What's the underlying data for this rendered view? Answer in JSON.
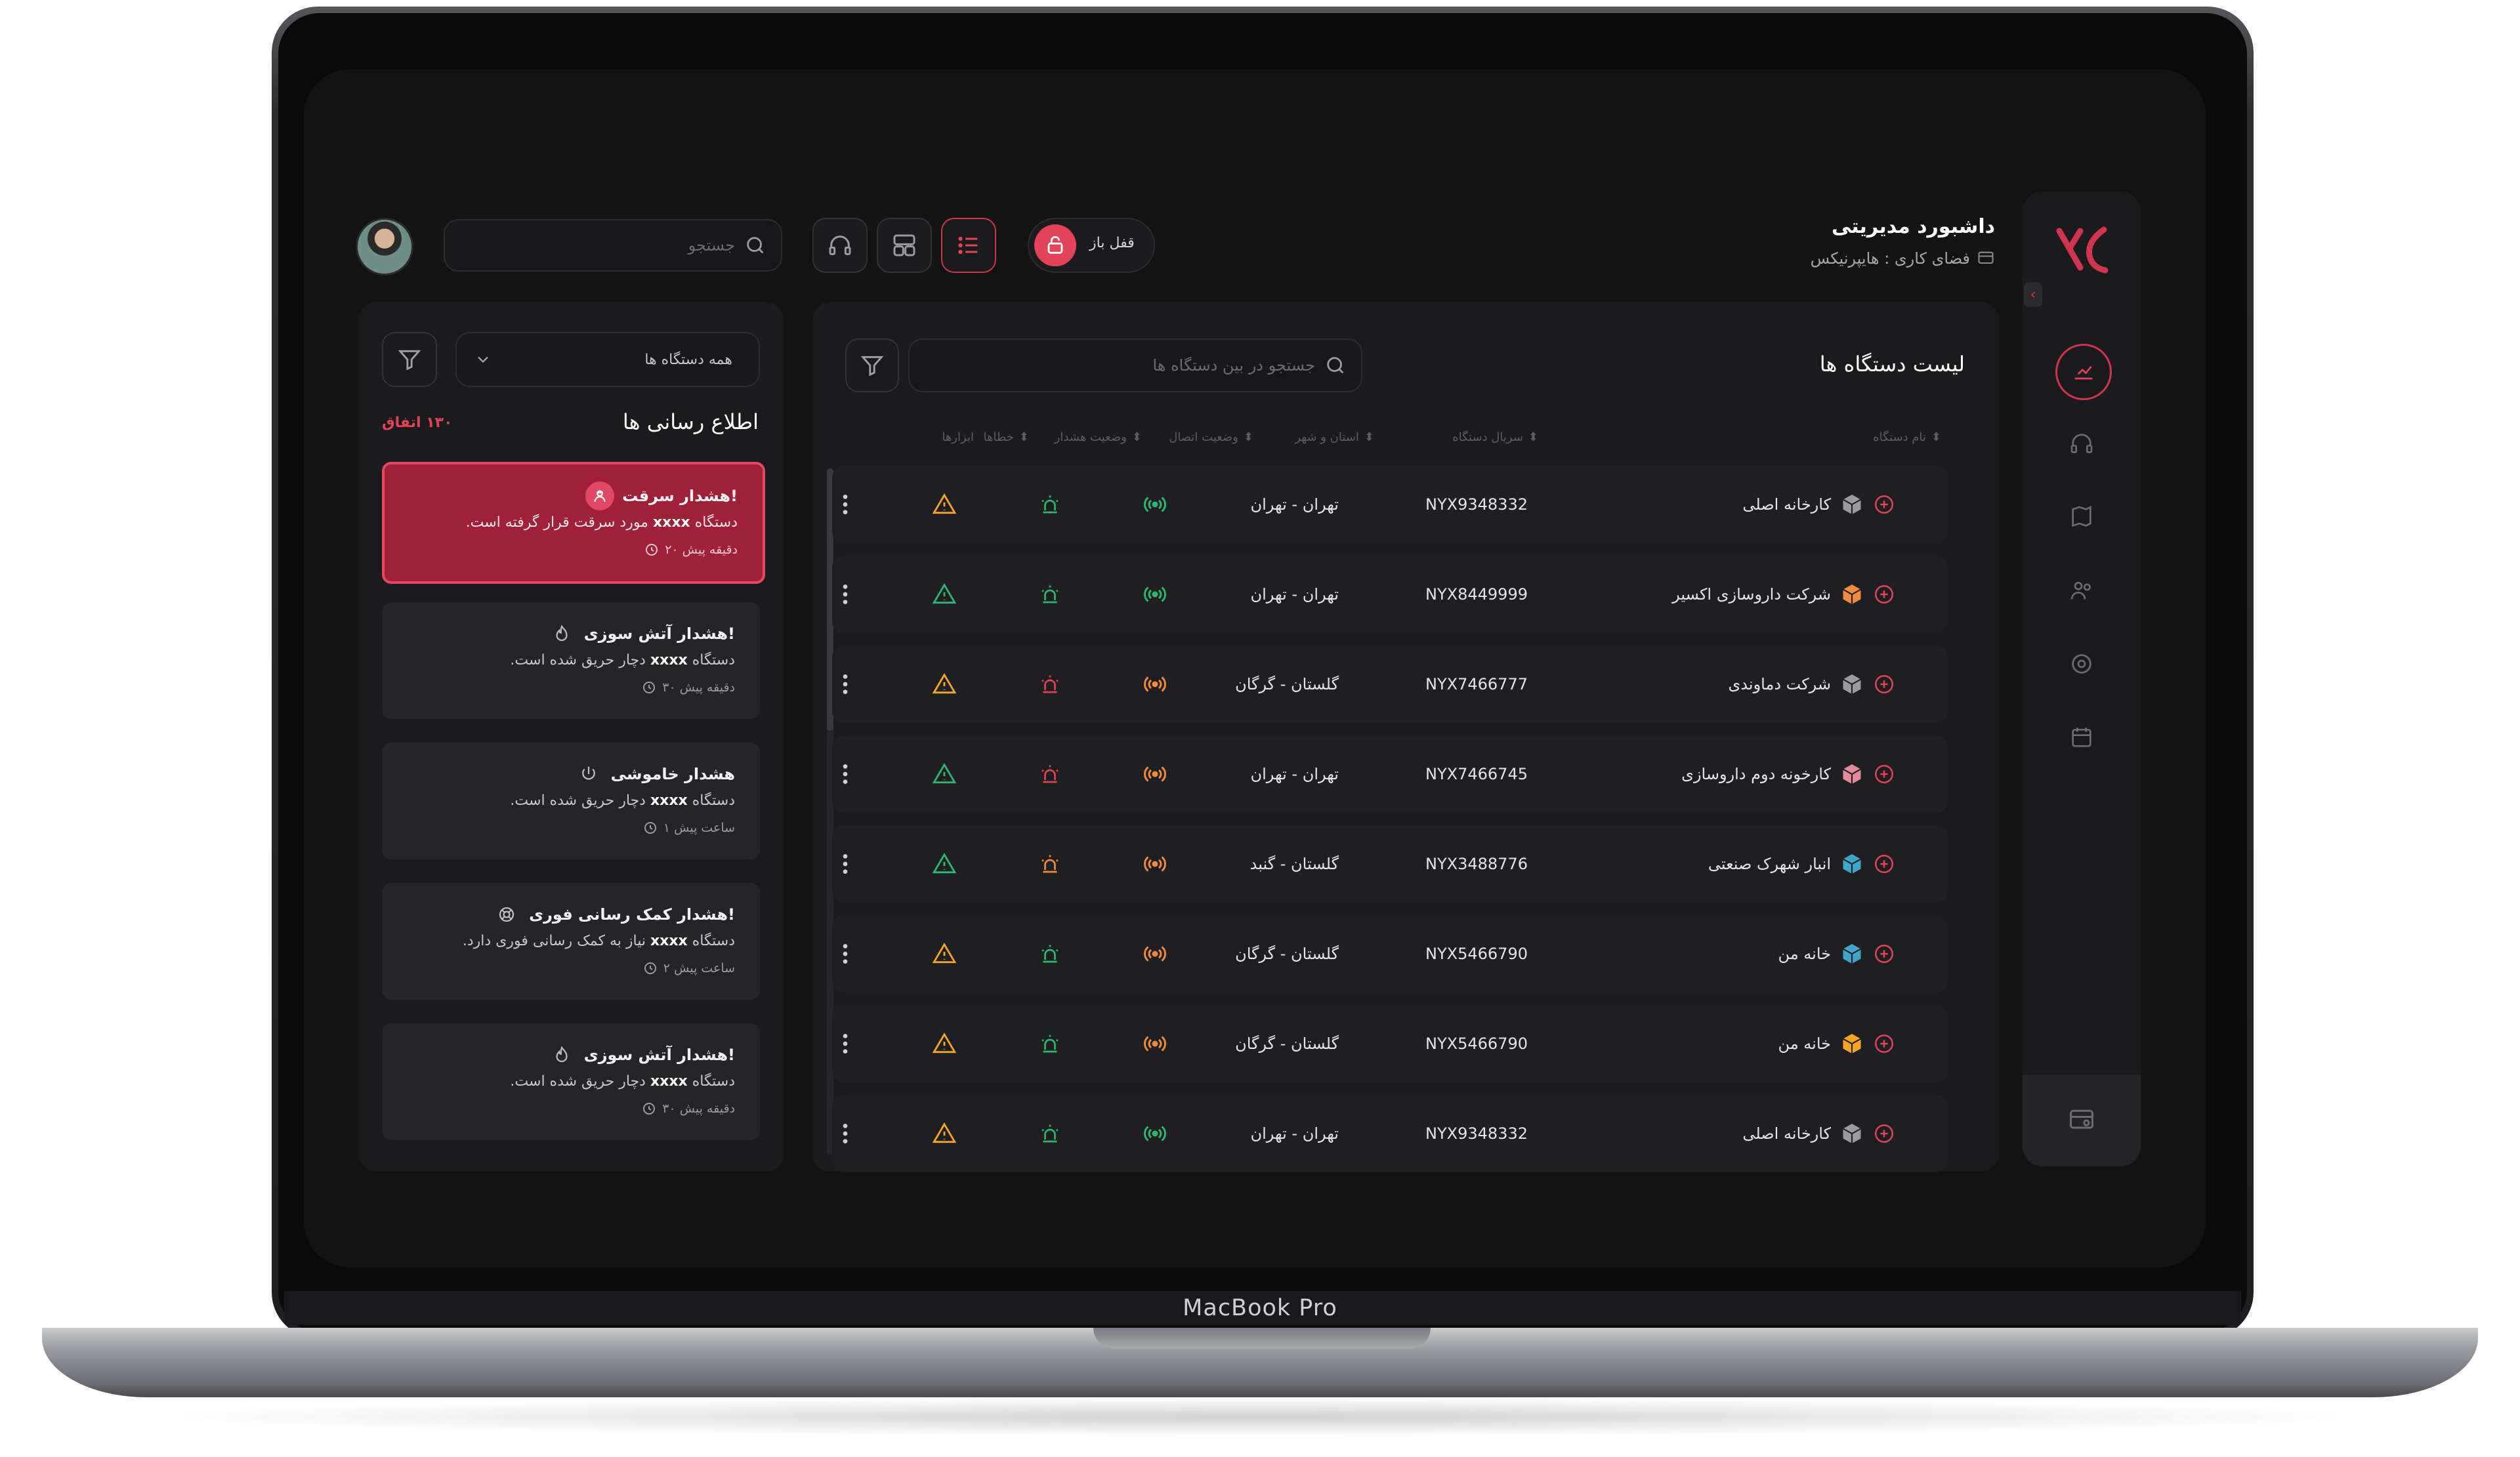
{
  "device_label": "MacBook Pro",
  "app": {
    "title": "داشبورد مدیریتی",
    "workspace_label": "فضای کاری : هایپرنیکس",
    "lock_label": "قفل باز",
    "search_placeholder": "جستجو",
    "accent": "#d1344e"
  },
  "sidebar": {
    "items": [
      {
        "icon": "dashboard-icon",
        "active": true
      },
      {
        "icon": "headset-icon"
      },
      {
        "icon": "map-icon"
      },
      {
        "icon": "users-icon"
      },
      {
        "icon": "settings-icon"
      },
      {
        "icon": "calendar-icon"
      }
    ],
    "bottom_icon": "workspace-icon"
  },
  "devices": {
    "title": "لیست دستگاه ها",
    "search_placeholder": "جستجو در بین دستگاه ها",
    "columns": {
      "name": "نام دستگاه",
      "serial": "سریال دستگاه",
      "location": "استان و شهر",
      "connection": "وضعیت اتصال",
      "alarm": "وضعیت هشدار",
      "errors": "خطاها",
      "tools": "ابزارها"
    },
    "rows": [
      {
        "name": "کارخانه اصلی",
        "serial": "NYX9348332",
        "location": "تهران - تهران",
        "cube": "#9a9aa0",
        "connection": "#2bb673",
        "alarm": "#2bb673",
        "error": "#f5a524"
      },
      {
        "name": "شرکت داروسازی اکسیر",
        "serial": "NYX8449999",
        "location": "تهران - تهران",
        "cube": "#f08a3c",
        "connection": "#2bb673",
        "alarm": "#2bb673",
        "error": "#2bb673"
      },
      {
        "name": "شرکت دماوندی",
        "serial": "NYX7466777",
        "location": "گلستان - گرگان",
        "cube": "#9a9aa0",
        "connection": "#f08a3c",
        "alarm": "#e0435a",
        "error": "#f5a524"
      },
      {
        "name": "کارخونه دوم داروسازی",
        "serial": "NYX7466745",
        "location": "تهران - تهران",
        "cube": "#e58a9a",
        "connection": "#f08a3c",
        "alarm": "#e0435a",
        "error": "#2bb673"
      },
      {
        "name": "انبار شهرک صنعتی",
        "serial": "NYX3488776",
        "location": "گلستان - گنبد",
        "cube": "#3ea7c9",
        "connection": "#f08a3c",
        "alarm": "#f08a3c",
        "error": "#2bb673"
      },
      {
        "name": "خانه من",
        "serial": "NYX5466790",
        "location": "گلستان - گرگان",
        "cube": "#3ea7c9",
        "connection": "#f08a3c",
        "alarm": "#2bb673",
        "error": "#f5a524"
      },
      {
        "name": "خانه من",
        "serial": "NYX5466790",
        "location": "گلستان - گرگان",
        "cube": "#f5a524",
        "connection": "#f08a3c",
        "alarm": "#2bb673",
        "error": "#f5a524"
      },
      {
        "name": "کارخانه اصلی",
        "serial": "NYX9348332",
        "location": "تهران - تهران",
        "cube": "#9a9aa0",
        "connection": "#2bb673",
        "alarm": "#2bb673",
        "error": "#f5a524"
      }
    ]
  },
  "notifications": {
    "title": "اطلاع رسانی ها",
    "count": "۱۳۰ اتفاق",
    "filter_value": "همه دستگاه ها",
    "items": [
      {
        "title": "هشدار سرقت!",
        "icon": "thief-icon",
        "body_prefix": "دستگاه",
        "code": "xxxx",
        "body_suffix": "مورد سرقت قرار گرفته است.",
        "time": "۲۰ دقیقه پیش",
        "highlight": true
      },
      {
        "title": "هشدار آتش سوزی!",
        "icon": "fire-icon",
        "body_prefix": "دستگاه",
        "code": "xxxx",
        "body_suffix": "دچار حریق شده است.",
        "time": "۳۰ دقیقه پیش",
        "highlight": false
      },
      {
        "title": "هشدار خاموشی",
        "icon": "power-icon",
        "body_prefix": "دستگاه",
        "code": "xxxx",
        "body_suffix": "دچار حریق شده است.",
        "time": "۱ ساعت پیش",
        "highlight": false
      },
      {
        "title": "هشدار کمک رسانی فوری!",
        "icon": "lifebuoy-icon",
        "body_prefix": "دستگاه",
        "code": "xxxx",
        "body_suffix": "نیاز به کمک رسانی فوری دارد.",
        "time": "۲ ساعت پیش",
        "highlight": false
      },
      {
        "title": "هشدار آتش سوزی!",
        "icon": "fire-icon",
        "body_prefix": "دستگاه",
        "code": "xxxx",
        "body_suffix": "دچار حریق شده است.",
        "time": "۳۰ دقیقه پیش",
        "highlight": false
      }
    ]
  }
}
